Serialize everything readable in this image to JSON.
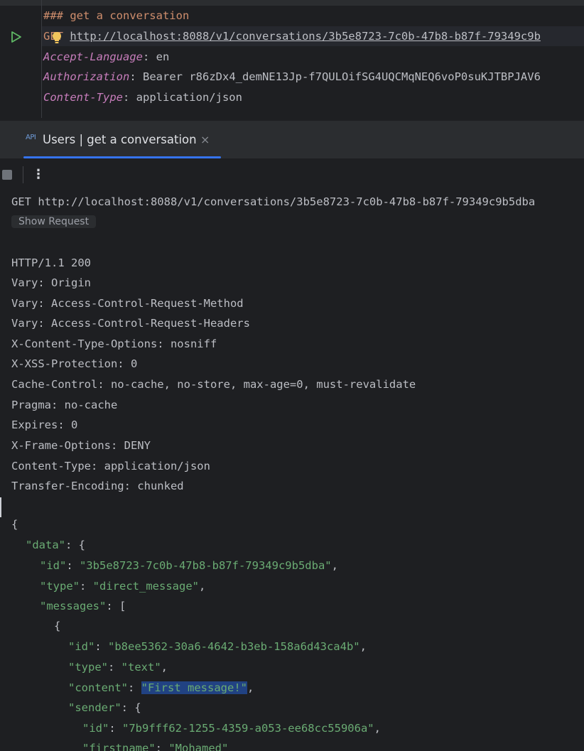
{
  "editor": {
    "comment_line": "### get a conversation",
    "method": "GET",
    "url": "http://localhost:8088/v1/conversations/3b5e8723-7c0b-47b8-b87f-79349c9b",
    "headers": [
      {
        "key": "Accept-Language",
        "sep": ": ",
        "value": "en"
      },
      {
        "key": "Authorization",
        "sep": ": ",
        "value": "Bearer r86zDx4_demNE13Jp-f7QULOifSG4UQCMqNEQ6voP0suKJTBPJAV6"
      },
      {
        "key": "Content-Type",
        "sep": ": ",
        "value": "application/json"
      }
    ]
  },
  "tab": {
    "icon_top": "API",
    "label": "Users | get a conversation",
    "close": "×"
  },
  "toolbar": {
    "more": "⋮"
  },
  "response": {
    "request_line": "GET http://localhost:8088/v1/conversations/3b5e8723-7c0b-47b8-b87f-79349c9b5dba",
    "show_request_label": "Show Request",
    "status_line": "HTTP/1.1 200",
    "headers": [
      "Vary: Origin",
      "Vary: Access-Control-Request-Method",
      "Vary: Access-Control-Request-Headers",
      "X-Content-Type-Options: nosniff",
      "X-XSS-Protection: 0",
      "Cache-Control: no-cache, no-store, max-age=0, must-revalidate",
      "Pragma: no-cache",
      "Expires: 0",
      "X-Frame-Options: DENY",
      "Content-Type: application/json",
      "Transfer-Encoding: chunked"
    ],
    "body": {
      "open_brace": "{",
      "data_key": "\"data\"",
      "data_open": ": {",
      "id_key": "\"id\"",
      "id_value": "\"3b5e8723-7c0b-47b8-b87f-79349c9b5dba\"",
      "type_key": "\"type\"",
      "type_value": "\"direct_message\"",
      "messages_key": "\"messages\"",
      "messages_open": ": [",
      "item_open": "{",
      "msg_id_key": "\"id\"",
      "msg_id_value": "\"b8ee5362-30a6-4642-b3eb-158a6d43ca4b\"",
      "msg_type_key": "\"type\"",
      "msg_type_value": "\"text\"",
      "content_key": "\"content\"",
      "content_value": "\"First message!\"",
      "sender_key": "\"sender\"",
      "sender_open": ": {",
      "sender_id_key": "\"id\"",
      "sender_id_value": "\"7b9fff62-1255-4359-a053-ee68cc55906a\"",
      "firstname_key": "\"firstname\"",
      "firstname_value": "\"Mohamed\""
    }
  }
}
